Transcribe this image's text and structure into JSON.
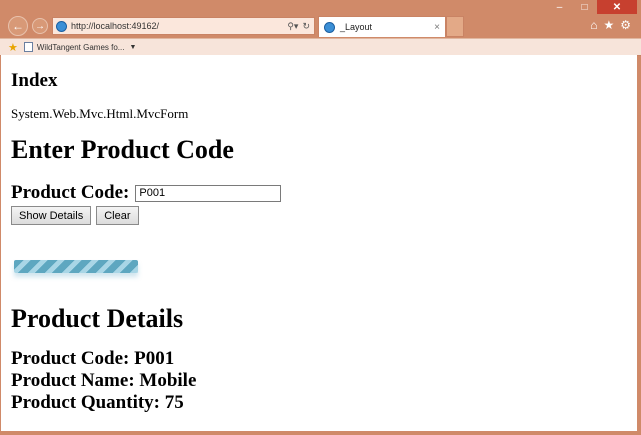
{
  "browser": {
    "address_url": "http://localhost:49162/",
    "search_icon": "search-icon",
    "tab_title": "_Layout",
    "tab_close": "×",
    "favorites": [
      {
        "label": "WildTangent Games fo..."
      }
    ],
    "toolbar_icons": [
      "home-icon",
      "star-icon",
      "gear-icon"
    ]
  },
  "page": {
    "index_heading": "Index",
    "form_text": "System.Web.Mvc.Html.MvcForm",
    "enter_heading": "Enter Product Code",
    "product_code_label": "Product Code:",
    "product_code_value": "P001",
    "show_details_label": "Show Details",
    "clear_label": "Clear",
    "details_heading": "Product Details",
    "detail_code": "Product Code: P001",
    "detail_name": "Product Name: Mobile",
    "detail_quantity": "Product Quantity: 75"
  },
  "colors": {
    "window_frame": "#d08a69",
    "close_button": "#c7402f",
    "loader_dark": "#5ea7c0",
    "loader_light": "#a9d6e6"
  }
}
